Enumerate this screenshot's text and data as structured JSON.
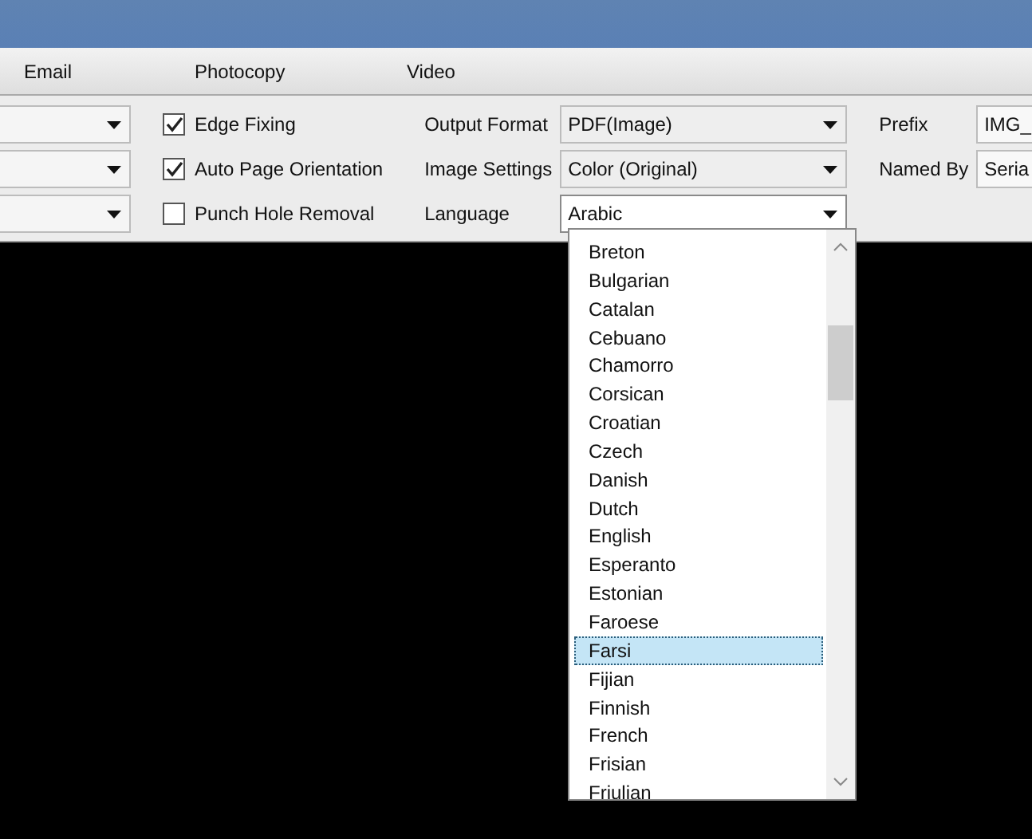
{
  "tabs": [
    {
      "label": "Email"
    },
    {
      "label": "Photocopy"
    },
    {
      "label": "Video"
    }
  ],
  "left_combos": [
    {
      "kind": "dropdown"
    },
    {
      "kind": "dropdown"
    },
    {
      "kind": "dropdown"
    }
  ],
  "options": [
    {
      "label": "Edge Fixing",
      "checked": true
    },
    {
      "label": "Auto Page Orientation",
      "checked": true
    },
    {
      "label": "Punch Hole Removal",
      "checked": false
    }
  ],
  "settings": [
    {
      "label": "Output Format",
      "value": "PDF(Image)",
      "open": false
    },
    {
      "label": "Image Settings",
      "value": "Color (Original)",
      "open": false
    },
    {
      "label": "Language",
      "value": "Arabic",
      "open": true
    }
  ],
  "naming": [
    {
      "label": "Prefix",
      "value": "IMG_"
    },
    {
      "label": "Named By",
      "value": "Seria"
    }
  ],
  "language_list": [
    {
      "label": "Breton",
      "selected": false
    },
    {
      "label": "Bulgarian",
      "selected": false
    },
    {
      "label": "Catalan",
      "selected": false
    },
    {
      "label": "Cebuano",
      "selected": false
    },
    {
      "label": "Chamorro",
      "selected": false
    },
    {
      "label": "Corsican",
      "selected": false
    },
    {
      "label": "Croatian",
      "selected": false
    },
    {
      "label": "Czech",
      "selected": false
    },
    {
      "label": "Danish",
      "selected": false
    },
    {
      "label": "Dutch",
      "selected": false
    },
    {
      "label": "English",
      "selected": false
    },
    {
      "label": "Esperanto",
      "selected": false
    },
    {
      "label": "Estonian",
      "selected": false
    },
    {
      "label": "Faroese",
      "selected": false
    },
    {
      "label": "Farsi",
      "selected": true
    },
    {
      "label": "Fijian",
      "selected": false
    },
    {
      "label": "Finnish",
      "selected": false
    },
    {
      "label": "French",
      "selected": false
    },
    {
      "label": "Frisian",
      "selected": false
    },
    {
      "label": "Friulian",
      "selected": false
    }
  ]
}
